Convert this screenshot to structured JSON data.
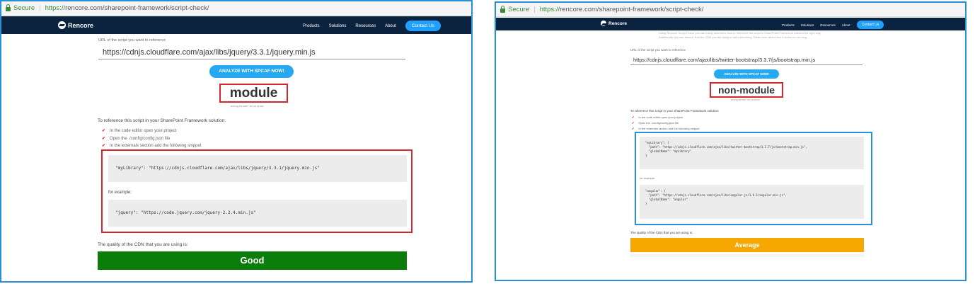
{
  "colors": {
    "nav_bg": "#0c2340",
    "accent_blue": "#27a9f1",
    "highlight_red": "#d9262c",
    "frame_blue": "#2a8fd6",
    "good_green": "#0a7d0a",
    "average_orange": "#f7a800",
    "check_red": "#d9262c"
  },
  "left": {
    "browser": {
      "secure_label": "Secure",
      "url_scheme": "https://",
      "url_rest": "rencore.com/sharepoint-framework/script-check/"
    },
    "nav": {
      "logo": "Rencore",
      "items": [
        "Products",
        "Solutions",
        "Resources",
        "About"
      ],
      "contact": "Contact Us"
    },
    "form": {
      "url_label": "URL of the script you want to reference",
      "url_value": "https://cdnjs.cloudflare.com/ajax/libs/jquery/3.3.1/jquery.min.js",
      "analyze_label": "ANALYZE WITH SPCAF NOW!"
    },
    "result": {
      "format": "module",
      "hint": "wrong format? let us know"
    },
    "instructions": {
      "intro": "To reference this script in your SharePoint Framework solution:",
      "steps": [
        "In the code editor open your project",
        "Open the ./config/config.json file",
        "In the externals section add the following snippet"
      ],
      "snippet": "\"myLibrary\": \"https://cdnjs.cloudflare.com/ajax/libs/jquery/3.3.1/jquery.min.js\"",
      "example_label": "for example:",
      "example": "\"jquery\": \"https://code.jquery.com/jquery-2.2.4.min.js\""
    },
    "quality": {
      "label": "The quality of the CDN that you are using is:",
      "value": "Good"
    }
  },
  "right": {
    "browser": {
      "secure_label": "Secure",
      "url_scheme": "https://",
      "url_rest": "rencore.com/sharepoint-framework/script-check/"
    },
    "nav": {
      "logo": "Rencore",
      "items": [
        "Products",
        "Solutions",
        "Resources",
        "About"
      ],
      "contact": "Contact Us"
    },
    "intro_faded": [
      "Using Rencore Script Check you can easily determine how to reference the script in SharePoint Framework solution the right way.",
      "Additionally you can ensure, that the CDN you are using is well performing. Read more about how it works on our blog."
    ],
    "form": {
      "url_label": "URL of the script you want to reference",
      "url_value": "https://cdnjs.cloudflare.com/ajax/libs/twitter-bootstrap/3.3.7/js/bootstrap.min.js",
      "analyze_label": "ANALYZE WITH SPCAF NOW!"
    },
    "result": {
      "format": "non-module",
      "hint": "wrong format? let us know"
    },
    "instructions": {
      "intro": "To reference this script in your SharePoint Framework solution:",
      "steps": [
        "In the code editor open your project",
        "Open the ./config/config.json file",
        "In the externals section add the following snippet"
      ],
      "snippet": "\"myLibrary\": {\n  \"path\": \"https://cdnjs.cloudflare.com/ajax/libs/twitter-bootstrap/3.3.7/js/bootstrap.min.js\",\n  \"globalName\": \"myLibrary\"\n}",
      "example_label": "for example:",
      "example": "\"angular\": {\n  \"path\": \"https://cdnjs.cloudflare.com/ajax/libs/angular.js/1.6.1/angular.min.js\",\n  \"globalName\": \"angular\"\n}"
    },
    "quality": {
      "label": "The quality of the CDN that you are using is:",
      "value": "Average"
    }
  }
}
